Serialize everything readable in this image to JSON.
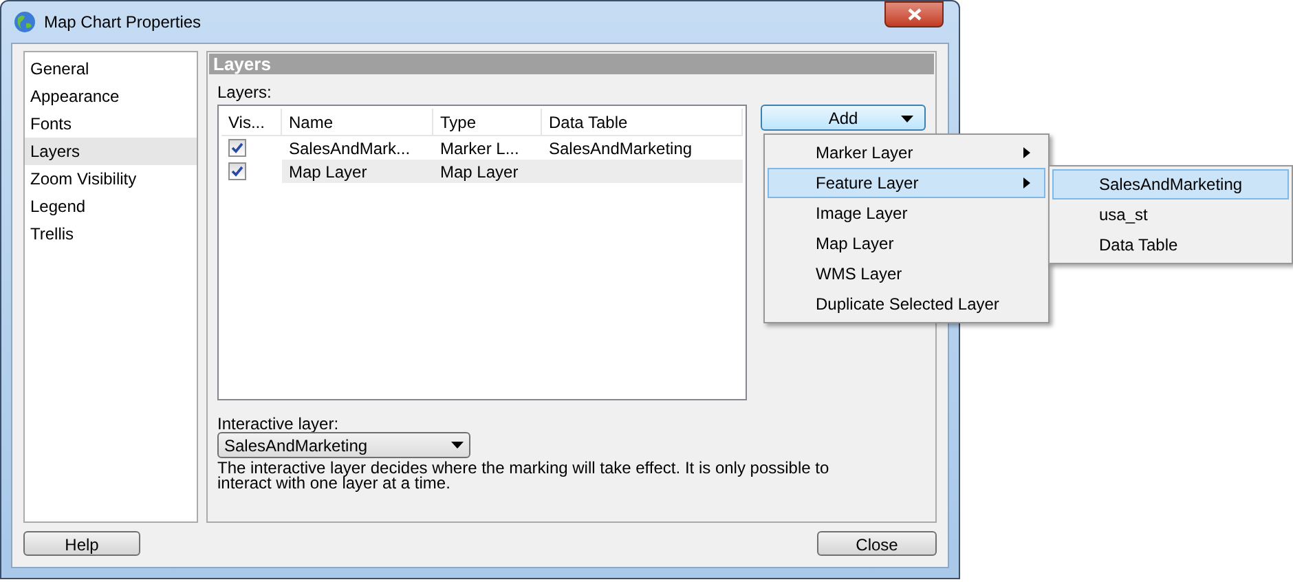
{
  "window": {
    "title": "Map Chart Properties"
  },
  "sidebar": {
    "items": [
      {
        "label": "General",
        "selected": false
      },
      {
        "label": "Appearance",
        "selected": false
      },
      {
        "label": "Fonts",
        "selected": false
      },
      {
        "label": "Layers",
        "selected": true
      },
      {
        "label": "Zoom Visibility",
        "selected": false
      },
      {
        "label": "Legend",
        "selected": false
      },
      {
        "label": "Trellis",
        "selected": false
      }
    ]
  },
  "panel": {
    "header": "Layers",
    "layers_label": "Layers:",
    "table": {
      "columns": [
        "Vis...",
        "Name",
        "Type",
        "Data Table"
      ],
      "rows": [
        {
          "visible": true,
          "selected": false,
          "name": "SalesAndMark...",
          "type": "Marker L...",
          "data_table": "SalesAndMarketing"
        },
        {
          "visible": true,
          "selected": true,
          "name": "Map Layer",
          "type": "Map Layer",
          "data_table": ""
        }
      ]
    },
    "add_button": "Add",
    "interactive_label": "Interactive layer:",
    "interactive_value": "SalesAndMarketing",
    "description": "The interactive layer decides where the marking will take effect. It is only possible to interact with one layer at a time."
  },
  "menu": {
    "items": [
      {
        "label": "Marker Layer",
        "submenu": true,
        "selected": false
      },
      {
        "label": "Feature Layer",
        "submenu": true,
        "selected": true
      },
      {
        "label": "Image Layer",
        "submenu": false,
        "selected": false
      },
      {
        "label": "Map Layer",
        "submenu": false,
        "selected": false
      },
      {
        "label": "WMS Layer",
        "submenu": false,
        "selected": false
      },
      {
        "label": "Duplicate Selected Layer",
        "submenu": false,
        "selected": false
      }
    ]
  },
  "submenu": {
    "items": [
      {
        "label": "SalesAndMarketing",
        "selected": true
      },
      {
        "label": "usa_st",
        "selected": false
      },
      {
        "label": "Data Table",
        "selected": false
      }
    ]
  },
  "buttons": {
    "help": "Help",
    "close": "Close"
  }
}
